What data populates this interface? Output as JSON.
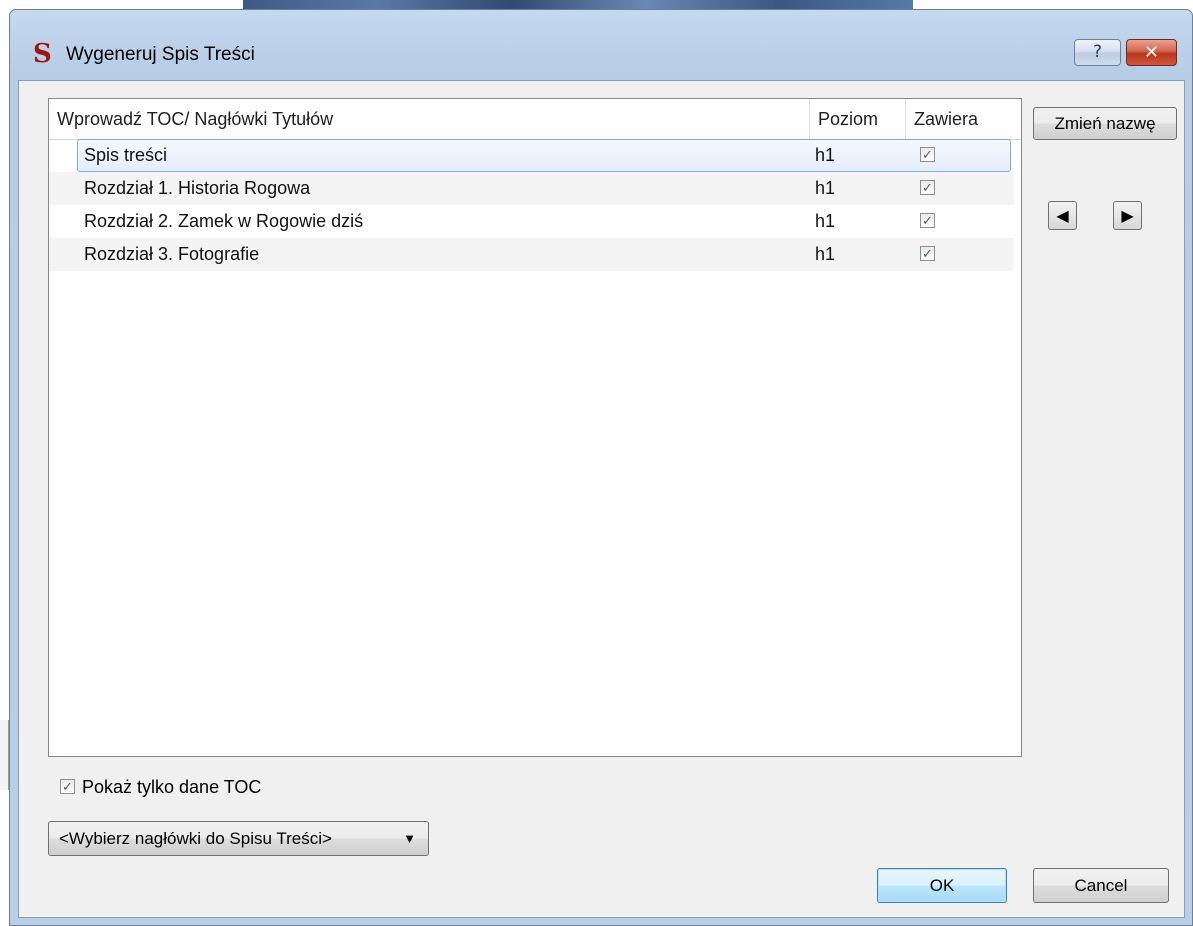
{
  "window": {
    "title": "Wygeneruj Spis Treści",
    "app_icon_glyph": "S",
    "help_label": "?",
    "close_label": "✕"
  },
  "table": {
    "columns": [
      "Wprowadź TOC/ Nagłówki Tytułów",
      "Poziom",
      "Zawiera"
    ],
    "rows": [
      {
        "title": "Spis treści",
        "level": "h1",
        "included": true,
        "selected": true
      },
      {
        "title": "Rozdział 1. Historia Rogowa",
        "level": "h1",
        "included": true,
        "selected": false
      },
      {
        "title": "Rozdział 2. Zamek w Rogowie dziś",
        "level": "h1",
        "included": true,
        "selected": false
      },
      {
        "title": "Rozdział 3. Fotografie",
        "level": "h1",
        "included": true,
        "selected": false
      }
    ]
  },
  "side": {
    "rename_label": "Zmień nazwę",
    "left_arrow_icon": "triangle-left-icon",
    "right_arrow_icon": "triangle-right-icon"
  },
  "bottom": {
    "show_toc_label": "Pokaż tylko dane TOC",
    "show_toc_checked": true,
    "select_value": "<Wybierz nagłówki do Spisu Treści>",
    "ok_label": "OK",
    "cancel_label": "Cancel"
  },
  "colors": {
    "title_bar": "#b9cfe6",
    "close_button": "#c9452a",
    "selection_border": "#84acdd",
    "client_bg": "#f0f0f0"
  }
}
